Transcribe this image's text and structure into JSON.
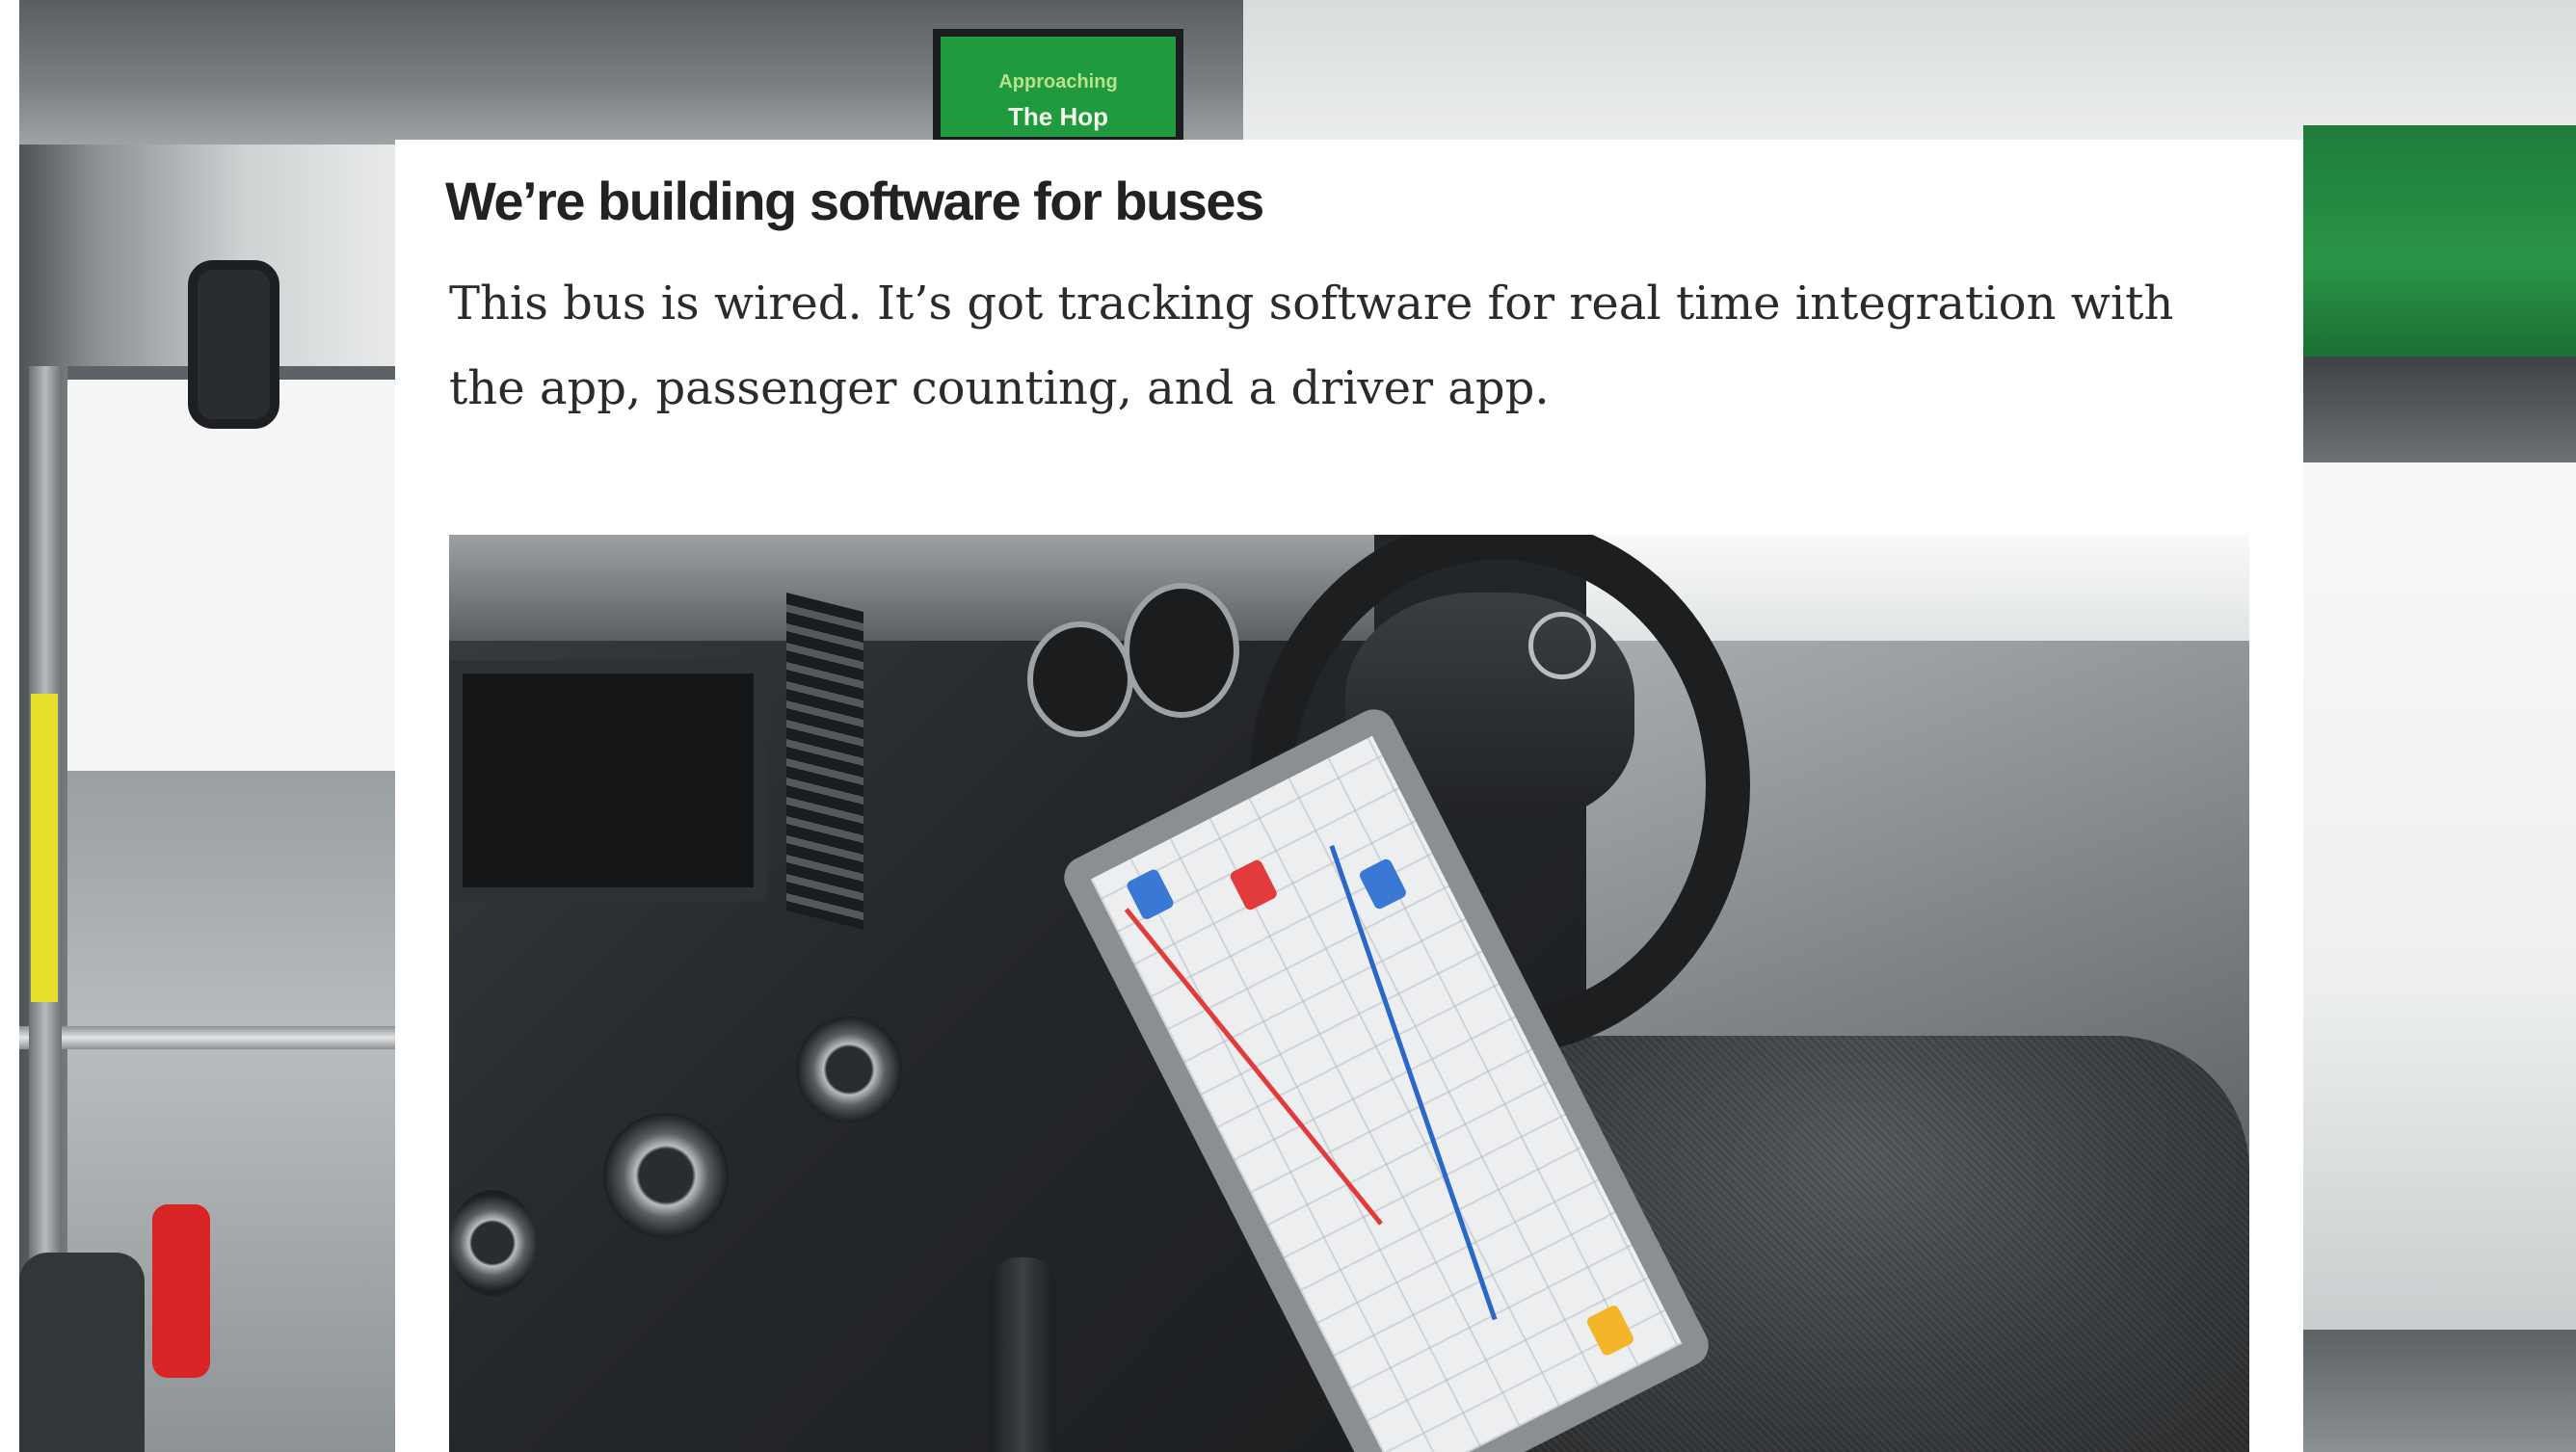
{
  "background": {
    "sign_screen": {
      "line1": "Approaching",
      "line2": "The Hop"
    }
  },
  "article": {
    "title": "We’re building software for buses",
    "body": "This bus is wired. It’s got tracking software for real time integration with the app, passenger counting, and a driver app."
  },
  "colors": {
    "card_background": "#ffffff",
    "title_text": "#222222",
    "body_text": "#2b2b2b",
    "sign_green": "#1f9a3e"
  },
  "icons": {
    "driver_photo": "bus-cockpit-with-tablet-image",
    "background_photo": "bus-interior-image"
  }
}
